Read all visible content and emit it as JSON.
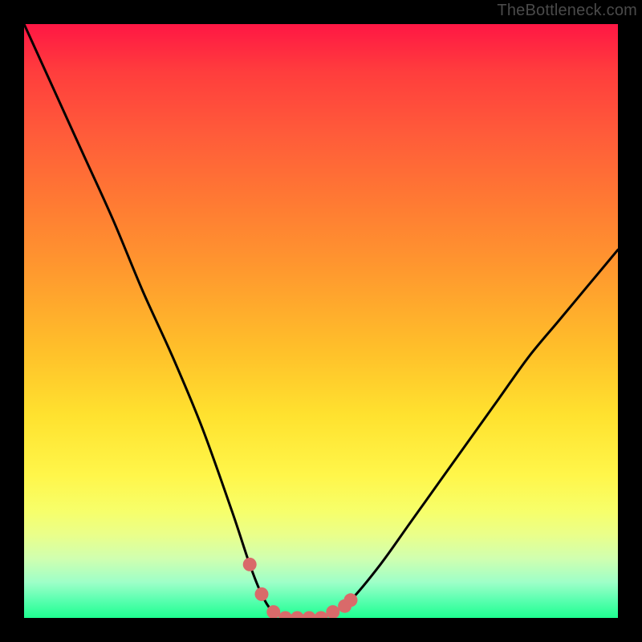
{
  "watermark": "TheBottleneck.com",
  "colors": {
    "page_bg": "#000000",
    "curve_stroke": "#000000",
    "marker_fill": "#d96a6a",
    "gradient_top": "#ff1744",
    "gradient_bottom": "#1eff90"
  },
  "chart_data": {
    "type": "line",
    "title": "",
    "xlabel": "",
    "ylabel": "",
    "xlim": [
      0,
      100
    ],
    "ylim": [
      0,
      100
    ],
    "grid": false,
    "legend": false,
    "series": [
      {
        "name": "bottleneck-curve",
        "x": [
          0,
          5,
          10,
          15,
          20,
          25,
          30,
          35,
          38,
          40,
          42,
          45,
          48,
          50,
          52,
          55,
          60,
          65,
          70,
          75,
          80,
          85,
          90,
          95,
          100
        ],
        "y": [
          100,
          89,
          78,
          67,
          55,
          44,
          32,
          18,
          9,
          4,
          1,
          0,
          0,
          0,
          1,
          3,
          9,
          16,
          23,
          30,
          37,
          44,
          50,
          56,
          62
        ]
      }
    ],
    "markers": {
      "name": "highlight-dots",
      "x": [
        38,
        40,
        42,
        44,
        46,
        48,
        50,
        52,
        54,
        55
      ],
      "y": [
        9,
        4,
        1,
        0,
        0,
        0,
        0,
        1,
        2,
        3
      ]
    }
  }
}
